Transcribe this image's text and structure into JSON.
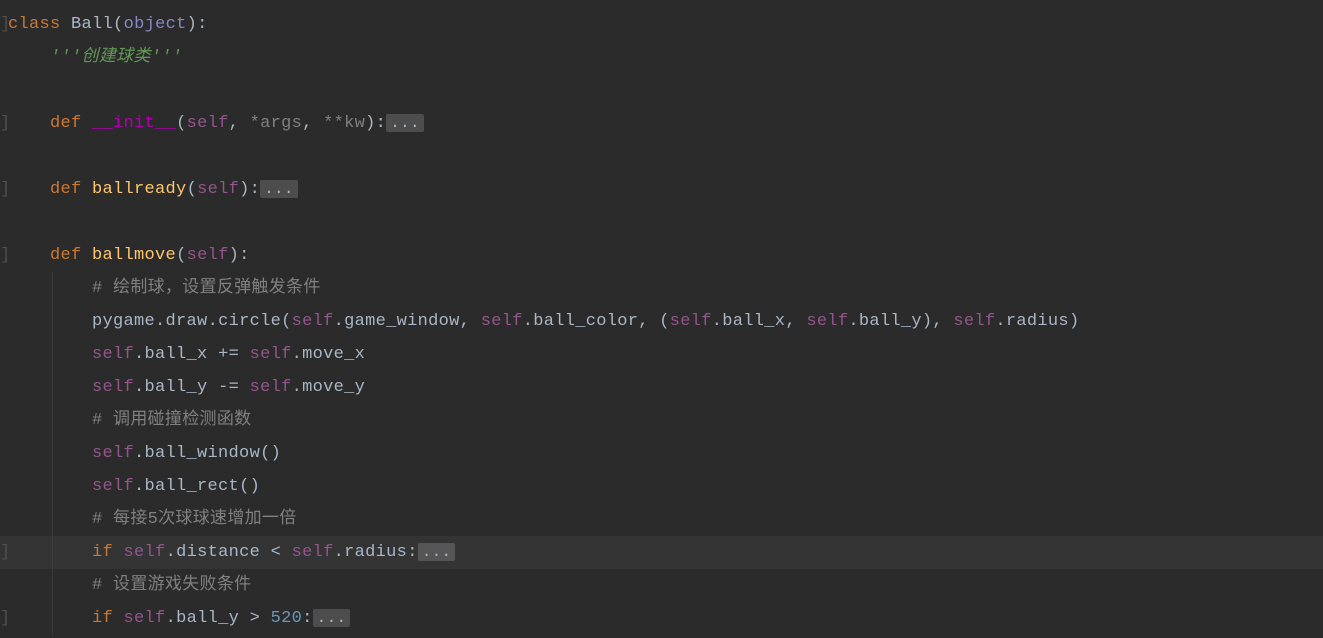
{
  "code": {
    "line1": {
      "kw_class": "class",
      "name": "Ball",
      "paren_open": "(",
      "builtin": "object",
      "paren_close": ")",
      "colon": ":"
    },
    "line2": {
      "docstring": "'''创建球类'''"
    },
    "line4": {
      "kw_def": "def",
      "name": "__init__",
      "paren_open": "(",
      "self": "self",
      "args": "*args",
      "kw": "**kw",
      "paren_close": ")",
      "colon": ":",
      "ellipsis": "..."
    },
    "line6": {
      "kw_def": "def",
      "name": "ballready",
      "paren_open": "(",
      "self": "self",
      "paren_close": ")",
      "colon": ":",
      "ellipsis": "..."
    },
    "line8": {
      "kw_def": "def",
      "name": "ballmove",
      "paren_open": "(",
      "self": "self",
      "paren_close": ")",
      "colon": ":"
    },
    "line9": {
      "comment": "# 绘制球，设置反弹触发条件"
    },
    "line10": {
      "pygame": "pygame",
      "draw": "draw",
      "circle": "circle",
      "self1": "self",
      "game_window": "game_window",
      "self2": "self",
      "ball_color": "ball_color",
      "self3": "self",
      "ball_x": "ball_x",
      "self4": "self",
      "ball_y": "ball_y",
      "self5": "self",
      "radius": "radius"
    },
    "line11": {
      "self1": "self",
      "ball_x": "ball_x",
      "op": "+=",
      "self2": "self",
      "move_x": "move_x"
    },
    "line12": {
      "self1": "self",
      "ball_y": "ball_y",
      "op": "-=",
      "self2": "self",
      "move_y": "move_y"
    },
    "line13": {
      "comment": "# 调用碰撞检测函数"
    },
    "line14": {
      "self": "self",
      "method": "ball_window"
    },
    "line15": {
      "self": "self",
      "method": "ball_rect"
    },
    "line16": {
      "comment": "# 每接5次球球速增加一倍"
    },
    "line17": {
      "kw_if": "if",
      "self1": "self",
      "distance": "distance",
      "op": "<",
      "self2": "self",
      "radius": "radius",
      "colon": ":",
      "ellipsis": "..."
    },
    "line18": {
      "comment": "# 设置游戏失败条件"
    },
    "line19": {
      "kw_if": "if",
      "self": "self",
      "ball_y": "ball_y",
      "op": ">",
      "num": "520",
      "colon": ":",
      "ellipsis": "..."
    }
  }
}
